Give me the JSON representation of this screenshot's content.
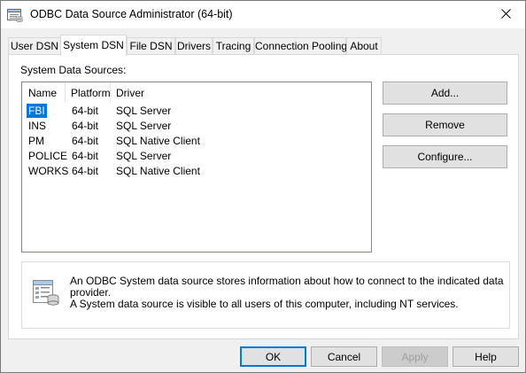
{
  "window": {
    "title": "ODBC Data Source Administrator (64-bit)",
    "close_label": "✕"
  },
  "tabs": [
    {
      "label": "User DSN",
      "active": false
    },
    {
      "label": "System DSN",
      "active": true
    },
    {
      "label": "File DSN",
      "active": false
    },
    {
      "label": "Drivers",
      "active": false
    },
    {
      "label": "Tracing",
      "active": false
    },
    {
      "label": "Connection Pooling",
      "active": false
    },
    {
      "label": "About",
      "active": false
    }
  ],
  "system_dsn": {
    "group_label": "System Data Sources:",
    "columns": [
      "Name",
      "Platform",
      "Driver"
    ],
    "rows": [
      {
        "name": "FBI",
        "platform": "64-bit",
        "driver": "SQL Server",
        "selected": true
      },
      {
        "name": "INS",
        "platform": "64-bit",
        "driver": "SQL Server",
        "selected": false
      },
      {
        "name": "PM",
        "platform": "64-bit",
        "driver": "SQL Native Client",
        "selected": false
      },
      {
        "name": "POLICE",
        "platform": "64-bit",
        "driver": "SQL Server",
        "selected": false
      },
      {
        "name": "WORKS",
        "platform": "64-bit",
        "driver": "SQL Native Client",
        "selected": false
      }
    ],
    "buttons": {
      "add": "Add...",
      "remove": "Remove",
      "configure": "Configure..."
    },
    "info_icon": "database-document-icon",
    "info_lines": [
      "An ODBC System data source stores information about how to connect to the indicated data provider.",
      "A System data source is visible to all users of this computer, including NT services."
    ]
  },
  "footer": {
    "ok": "OK",
    "cancel": "Cancel",
    "apply": "Apply",
    "help": "Help"
  },
  "colors": {
    "selection": "#0078d7",
    "default_button_border": "#0078d7"
  }
}
